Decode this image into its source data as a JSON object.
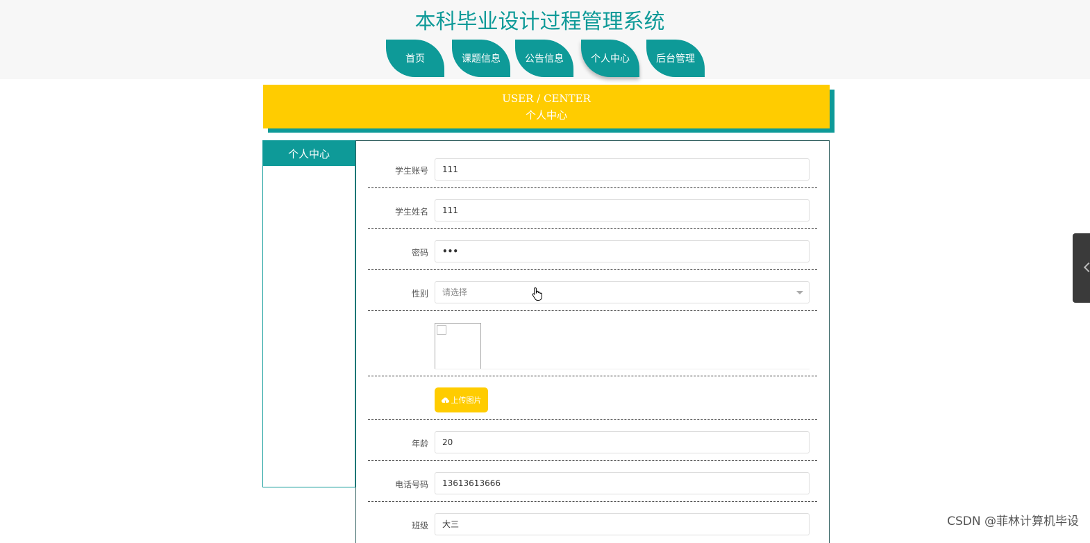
{
  "site_title": "本科毕业设计过程管理系统",
  "nav": {
    "items": [
      {
        "label": "首页"
      },
      {
        "label": "课题信息"
      },
      {
        "label": "公告信息"
      },
      {
        "label": "个人中心"
      },
      {
        "label": "后台管理"
      }
    ],
    "active": "个人中心"
  },
  "banner": {
    "en": "USER / CENTER",
    "cn": "个人中心"
  },
  "sidebar": {
    "title": "个人中心"
  },
  "form": {
    "student_account": {
      "label": "学生账号",
      "value": "111"
    },
    "student_name": {
      "label": "学生姓名",
      "value": "111"
    },
    "password": {
      "label": "密码",
      "value": "•••"
    },
    "gender": {
      "label": "性别",
      "placeholder": "请选择"
    },
    "upload_button": "上传图片",
    "age": {
      "label": "年龄",
      "value": "20"
    },
    "phone": {
      "label": "电话号码",
      "value": "13613613666"
    },
    "class": {
      "label": "班级",
      "value": "大三"
    }
  },
  "watermark": "CSDN @菲林计算机毕设",
  "colors": {
    "primary": "#0e9a98",
    "accent": "#ffcc00",
    "header_bg": "#f7f7f7"
  },
  "icons": [
    "cloud-upload-icon",
    "chevron-left-icon",
    "hand-cursor-icon",
    "broken-image-icon",
    "dropdown-caret-icon"
  ]
}
